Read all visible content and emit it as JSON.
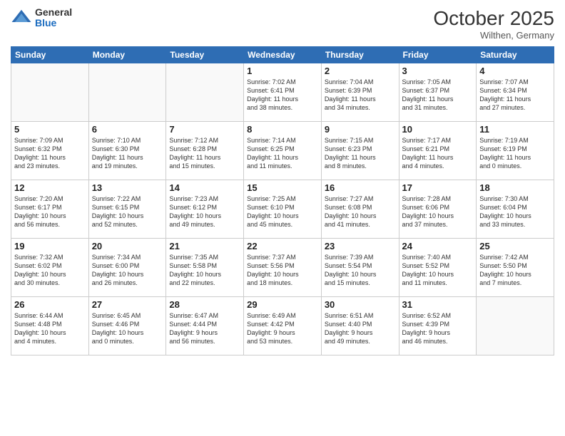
{
  "logo": {
    "general": "General",
    "blue": "Blue"
  },
  "header": {
    "month": "October 2025",
    "location": "Wilthen, Germany"
  },
  "weekdays": [
    "Sunday",
    "Monday",
    "Tuesday",
    "Wednesday",
    "Thursday",
    "Friday",
    "Saturday"
  ],
  "weeks": [
    [
      {
        "day": "",
        "info": ""
      },
      {
        "day": "",
        "info": ""
      },
      {
        "day": "",
        "info": ""
      },
      {
        "day": "1",
        "info": "Sunrise: 7:02 AM\nSunset: 6:41 PM\nDaylight: 11 hours\nand 38 minutes."
      },
      {
        "day": "2",
        "info": "Sunrise: 7:04 AM\nSunset: 6:39 PM\nDaylight: 11 hours\nand 34 minutes."
      },
      {
        "day": "3",
        "info": "Sunrise: 7:05 AM\nSunset: 6:37 PM\nDaylight: 11 hours\nand 31 minutes."
      },
      {
        "day": "4",
        "info": "Sunrise: 7:07 AM\nSunset: 6:34 PM\nDaylight: 11 hours\nand 27 minutes."
      }
    ],
    [
      {
        "day": "5",
        "info": "Sunrise: 7:09 AM\nSunset: 6:32 PM\nDaylight: 11 hours\nand 23 minutes."
      },
      {
        "day": "6",
        "info": "Sunrise: 7:10 AM\nSunset: 6:30 PM\nDaylight: 11 hours\nand 19 minutes."
      },
      {
        "day": "7",
        "info": "Sunrise: 7:12 AM\nSunset: 6:28 PM\nDaylight: 11 hours\nand 15 minutes."
      },
      {
        "day": "8",
        "info": "Sunrise: 7:14 AM\nSunset: 6:25 PM\nDaylight: 11 hours\nand 11 minutes."
      },
      {
        "day": "9",
        "info": "Sunrise: 7:15 AM\nSunset: 6:23 PM\nDaylight: 11 hours\nand 8 minutes."
      },
      {
        "day": "10",
        "info": "Sunrise: 7:17 AM\nSunset: 6:21 PM\nDaylight: 11 hours\nand 4 minutes."
      },
      {
        "day": "11",
        "info": "Sunrise: 7:19 AM\nSunset: 6:19 PM\nDaylight: 11 hours\nand 0 minutes."
      }
    ],
    [
      {
        "day": "12",
        "info": "Sunrise: 7:20 AM\nSunset: 6:17 PM\nDaylight: 10 hours\nand 56 minutes."
      },
      {
        "day": "13",
        "info": "Sunrise: 7:22 AM\nSunset: 6:15 PM\nDaylight: 10 hours\nand 52 minutes."
      },
      {
        "day": "14",
        "info": "Sunrise: 7:23 AM\nSunset: 6:12 PM\nDaylight: 10 hours\nand 49 minutes."
      },
      {
        "day": "15",
        "info": "Sunrise: 7:25 AM\nSunset: 6:10 PM\nDaylight: 10 hours\nand 45 minutes."
      },
      {
        "day": "16",
        "info": "Sunrise: 7:27 AM\nSunset: 6:08 PM\nDaylight: 10 hours\nand 41 minutes."
      },
      {
        "day": "17",
        "info": "Sunrise: 7:28 AM\nSunset: 6:06 PM\nDaylight: 10 hours\nand 37 minutes."
      },
      {
        "day": "18",
        "info": "Sunrise: 7:30 AM\nSunset: 6:04 PM\nDaylight: 10 hours\nand 33 minutes."
      }
    ],
    [
      {
        "day": "19",
        "info": "Sunrise: 7:32 AM\nSunset: 6:02 PM\nDaylight: 10 hours\nand 30 minutes."
      },
      {
        "day": "20",
        "info": "Sunrise: 7:34 AM\nSunset: 6:00 PM\nDaylight: 10 hours\nand 26 minutes."
      },
      {
        "day": "21",
        "info": "Sunrise: 7:35 AM\nSunset: 5:58 PM\nDaylight: 10 hours\nand 22 minutes."
      },
      {
        "day": "22",
        "info": "Sunrise: 7:37 AM\nSunset: 5:56 PM\nDaylight: 10 hours\nand 18 minutes."
      },
      {
        "day": "23",
        "info": "Sunrise: 7:39 AM\nSunset: 5:54 PM\nDaylight: 10 hours\nand 15 minutes."
      },
      {
        "day": "24",
        "info": "Sunrise: 7:40 AM\nSunset: 5:52 PM\nDaylight: 10 hours\nand 11 minutes."
      },
      {
        "day": "25",
        "info": "Sunrise: 7:42 AM\nSunset: 5:50 PM\nDaylight: 10 hours\nand 7 minutes."
      }
    ],
    [
      {
        "day": "26",
        "info": "Sunrise: 6:44 AM\nSunset: 4:48 PM\nDaylight: 10 hours\nand 4 minutes."
      },
      {
        "day": "27",
        "info": "Sunrise: 6:45 AM\nSunset: 4:46 PM\nDaylight: 10 hours\nand 0 minutes."
      },
      {
        "day": "28",
        "info": "Sunrise: 6:47 AM\nSunset: 4:44 PM\nDaylight: 9 hours\nand 56 minutes."
      },
      {
        "day": "29",
        "info": "Sunrise: 6:49 AM\nSunset: 4:42 PM\nDaylight: 9 hours\nand 53 minutes."
      },
      {
        "day": "30",
        "info": "Sunrise: 6:51 AM\nSunset: 4:40 PM\nDaylight: 9 hours\nand 49 minutes."
      },
      {
        "day": "31",
        "info": "Sunrise: 6:52 AM\nSunset: 4:39 PM\nDaylight: 9 hours\nand 46 minutes."
      },
      {
        "day": "",
        "info": ""
      }
    ]
  ]
}
